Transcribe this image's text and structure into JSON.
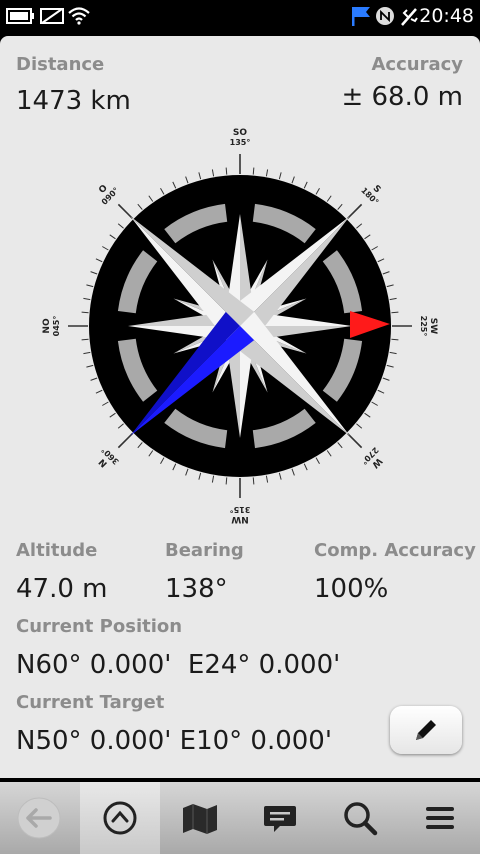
{
  "status": {
    "time": "20:48",
    "icons": [
      "battery-icon",
      "sim-off-icon",
      "wifi-icon",
      "flag-notification-icon",
      "nfc-icon",
      "usb-icon"
    ]
  },
  "info": {
    "distance_label": "Distance",
    "distance_value": "1473 km",
    "accuracy_label": "Accuracy",
    "accuracy_value": "± 68.0 m",
    "altitude_label": "Altitude",
    "altitude_value": "47.0 m",
    "bearing_label": "Bearing",
    "bearing_value": "138°",
    "comp_accuracy_label": "Comp. Accuracy",
    "comp_accuracy_value": "100%",
    "current_position_label": "Current Position",
    "current_position_value": "N60° 0.000'  E24° 0.000'",
    "current_target_label": "Current Target",
    "current_target_value": "N50° 0.000' E10° 0.000'"
  },
  "compass": {
    "labels": [
      {
        "name": "SO",
        "deg": "135°",
        "angle": 0
      },
      {
        "name": "S",
        "deg": "180°",
        "angle": 45
      },
      {
        "name": "SW",
        "deg": "225°",
        "angle": 90
      },
      {
        "name": "W",
        "deg": "270°",
        "angle": 135
      },
      {
        "name": "NW",
        "deg": "315°",
        "angle": 180
      },
      {
        "name": "N",
        "deg": "360°",
        "angle": 225
      },
      {
        "name": "NO",
        "deg": "045°",
        "angle": 270
      },
      {
        "name": "O",
        "deg": "090°",
        "angle": 315
      }
    ],
    "target_color": "#ff1a1a",
    "north_color": "#1b1bff"
  },
  "toolbar": {
    "items": [
      "back-arrow-icon",
      "compass-icon",
      "map-icon",
      "chat-bubble-icon",
      "search-icon",
      "menu-icon"
    ],
    "active": "compass-icon"
  }
}
